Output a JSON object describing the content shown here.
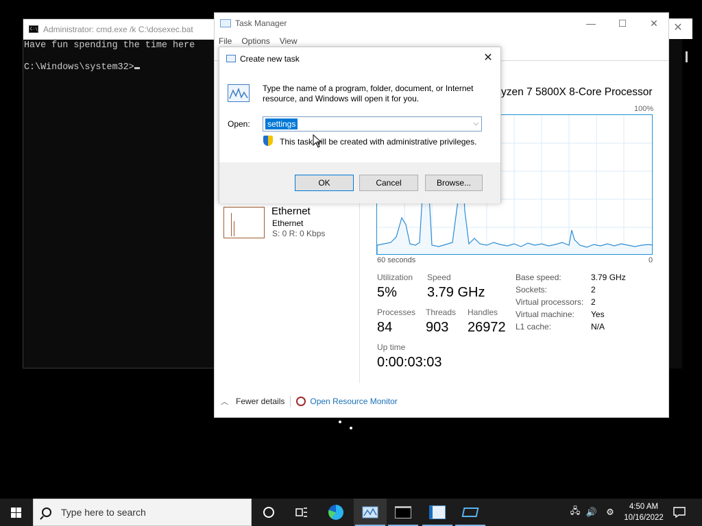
{
  "cmd": {
    "title": "Administrator: cmd.exe /k C:\\dosexec.bat",
    "line1": "Have fun spending the time here",
    "line2": "",
    "prompt": "C:\\Windows\\system32>"
  },
  "task_manager": {
    "title": "Task Manager",
    "menu": [
      "File",
      "Options",
      "View"
    ],
    "cpu_name_visible": "yzen 7 5800X 8-Core Processor",
    "graph_top_label": "100%",
    "graph_left_label": "60 seconds",
    "graph_right_label": "0",
    "ethernet": {
      "name": "Ethernet",
      "sub": "Ethernet",
      "speed": "S: 0 R: 0 Kbps"
    },
    "stats": {
      "utilization_label": "Utilization",
      "utilization_value": "5%",
      "speed_label": "Speed",
      "speed_value": "3.79 GHz",
      "processes_label": "Processes",
      "processes_value": "84",
      "threads_label": "Threads",
      "threads_value": "903",
      "handles_label": "Handles",
      "handles_value": "26972",
      "uptime_label": "Up time",
      "uptime_value": "0:00:03:03"
    },
    "specs": [
      {
        "key": "Base speed:",
        "value": "3.79 GHz"
      },
      {
        "key": "Sockets:",
        "value": "2"
      },
      {
        "key": "Virtual processors:",
        "value": "2"
      },
      {
        "key": "Virtual machine:",
        "value": "Yes"
      },
      {
        "key": "L1 cache:",
        "value": "N/A"
      }
    ],
    "footer": {
      "fewer_details": "Fewer details",
      "open_resource_monitor": "Open Resource Monitor"
    },
    "accent_color": "#1d8fd6"
  },
  "run_dialog": {
    "title": "Create new task",
    "description": "Type the name of a program, folder, document, or Internet resource, and Windows will open it for you.",
    "open_label": "Open:",
    "open_value": "settings",
    "privileges_note": "This task will be created with administrative privileges.",
    "ok_label": "OK",
    "cancel_label": "Cancel",
    "browse_label": "Browse..."
  },
  "taskbar": {
    "search_placeholder": "Type here to search",
    "time": "4:50 AM",
    "date": "10/16/2022",
    "pinned_icons": [
      "task-view-icon",
      "widgets-icon",
      "edge-icon",
      "task-manager-icon",
      "cmd-icon",
      "run-dialog-icon",
      "app-icon"
    ]
  }
}
